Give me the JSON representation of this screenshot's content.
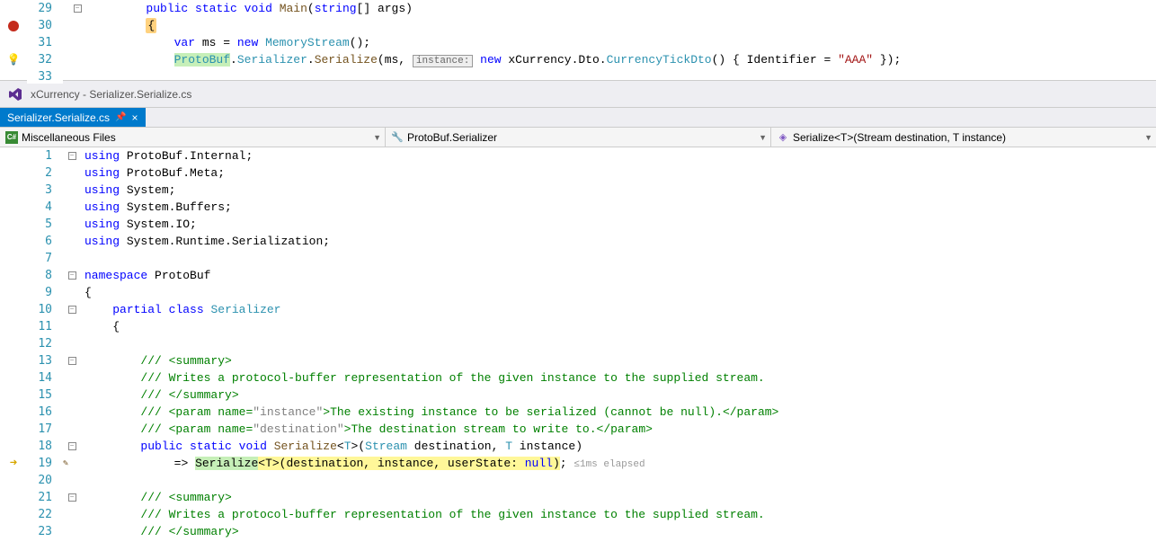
{
  "top_pane": {
    "rows": [
      {
        "ln": "29",
        "margin": "",
        "outline": "minus",
        "change": "",
        "html": "        <span class='kw'>public</span> <span class='kw'>static</span> <span class='kw'>void</span> <span class='method'>Main</span>(<span class='kw'>string</span>[] args)"
      },
      {
        "ln": "30",
        "margin": "breakpoint",
        "outline": "",
        "change": "",
        "html": "        <span class='hl-orange'>{</span>"
      },
      {
        "ln": "31",
        "margin": "",
        "outline": "",
        "change": "green",
        "html": "            <span class='kw'>var</span> ms = <span class='kw'>new</span> <span class='type'>MemoryStream</span>();"
      },
      {
        "ln": "32",
        "margin": "bulb",
        "outline": "",
        "change": "",
        "html": "            <span class='hl-green'><span class='type'>ProtoBuf</span></span>.<span class='type'>Serializer</span>.<span class='method'>Serialize</span>(ms, <span class='box-gray'>instance:</span> <span class='kw'>new</span> xCurrency.Dto.<span class='type'>CurrencyTickDto</span>() { Identifier = <span class='str'>\"AAA\"</span> });"
      },
      {
        "ln": "33",
        "margin": "",
        "outline": "",
        "change": "",
        "html": ""
      }
    ]
  },
  "title_bar": {
    "text": "xCurrency - Serializer.Serialize.cs"
  },
  "tab": {
    "label": "Serializer.Serialize.cs"
  },
  "nav": {
    "seg1": "Miscellaneous Files",
    "seg2": "ProtoBuf.Serializer",
    "seg3": "Serialize<T>(Stream destination, T instance)"
  },
  "bottom_pane": {
    "rows": [
      {
        "ln": "1",
        "margin": "",
        "outline": "minus",
        "html": "<span class='kw'>using</span> ProtoBuf.Internal;"
      },
      {
        "ln": "2",
        "margin": "",
        "outline": "",
        "html": "<span class='kw'>using</span> ProtoBuf.Meta;"
      },
      {
        "ln": "3",
        "margin": "",
        "outline": "",
        "html": "<span class='kw'>using</span> System;"
      },
      {
        "ln": "4",
        "margin": "",
        "outline": "",
        "html": "<span class='kw'>using</span> System.Buffers;"
      },
      {
        "ln": "5",
        "margin": "",
        "outline": "",
        "html": "<span class='kw'>using</span> System.IO;"
      },
      {
        "ln": "6",
        "margin": "",
        "outline": "",
        "html": "<span class='kw'>using</span> System.Runtime.Serialization;"
      },
      {
        "ln": "7",
        "margin": "",
        "outline": "",
        "html": ""
      },
      {
        "ln": "8",
        "margin": "",
        "outline": "minus",
        "html": "<span class='kw'>namespace</span> ProtoBuf"
      },
      {
        "ln": "9",
        "margin": "",
        "outline": "",
        "html": "{"
      },
      {
        "ln": "10",
        "margin": "",
        "outline": "minus",
        "html": "    <span class='kw'>partial</span> <span class='kw'>class</span> <span class='type'>Serializer</span>"
      },
      {
        "ln": "11",
        "margin": "",
        "outline": "",
        "html": "    {"
      },
      {
        "ln": "12",
        "margin": "",
        "outline": "",
        "html": ""
      },
      {
        "ln": "13",
        "margin": "",
        "outline": "minus",
        "html": "        <span class='comment'>/// &lt;summary&gt;</span>"
      },
      {
        "ln": "14",
        "margin": "",
        "outline": "",
        "html": "        <span class='comment'>/// Writes a protocol-buffer representation of the given instance to the supplied stream.</span>"
      },
      {
        "ln": "15",
        "margin": "",
        "outline": "",
        "html": "        <span class='comment'>/// &lt;/summary&gt;</span>"
      },
      {
        "ln": "16",
        "margin": "",
        "outline": "",
        "html": "        <span class='comment'>/// &lt;param name=</span><span class='param'>\"instance\"</span><span class='comment'>&gt;The existing instance to be serialized (cannot be null).&lt;/param&gt;</span>"
      },
      {
        "ln": "17",
        "margin": "",
        "outline": "",
        "html": "        <span class='comment'>/// &lt;param name=</span><span class='param'>\"destination\"</span><span class='comment'>&gt;The destination stream to write to.&lt;/param&gt;</span>"
      },
      {
        "ln": "18",
        "margin": "",
        "outline": "minus",
        "html": "        <span class='kw'>public</span> <span class='kw'>static</span> <span class='kw'>void</span> <span class='method'>Serialize</span>&lt;<span class='type'>T</span>&gt;(<span class='type'>Stream</span> destination, <span class='type'>T</span> instance)"
      },
      {
        "ln": "19",
        "margin": "arrow",
        "outline": "",
        "pencil": true,
        "html": "            =&gt; <span class='hl-green'>Serialize</span><span class='hl-yellow'>&lt;T&gt;(destination, instance, userState: <span class='kw'>null</span>)</span>; <span class='inline-hint'>≤1ms elapsed</span>"
      },
      {
        "ln": "20",
        "margin": "",
        "outline": "",
        "html": ""
      },
      {
        "ln": "21",
        "margin": "",
        "outline": "minus",
        "html": "        <span class='comment'>/// &lt;summary&gt;</span>"
      },
      {
        "ln": "22",
        "margin": "",
        "outline": "",
        "html": "        <span class='comment'>/// Writes a protocol-buffer representation of the given instance to the supplied stream.</span>"
      },
      {
        "ln": "23",
        "margin": "",
        "outline": "",
        "html": "        <span class='comment'>/// &lt;/summary&gt;</span>"
      }
    ]
  }
}
